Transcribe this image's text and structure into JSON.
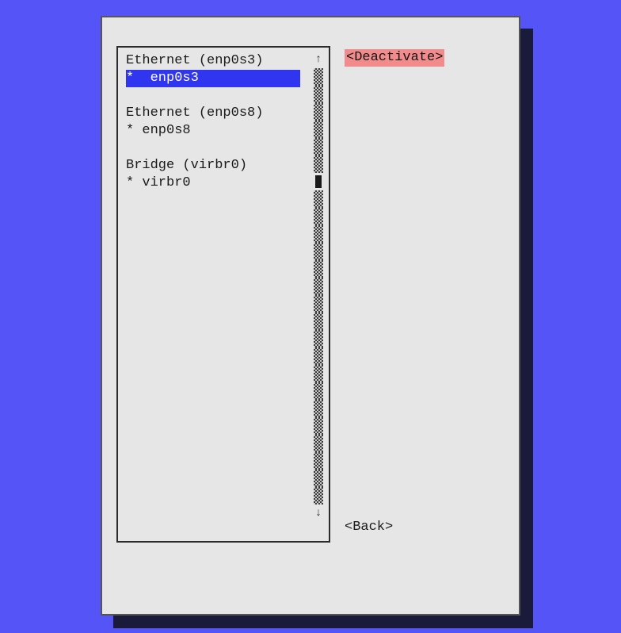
{
  "list": {
    "groups": [
      {
        "header": "Ethernet (enp0s3)",
        "itemPrefix": "* ",
        "itemName": "enp0s3",
        "selected": true
      },
      {
        "header": "Ethernet (enp0s8)",
        "itemPrefix": "* ",
        "itemName": "enp0s8",
        "selected": false
      },
      {
        "header": "Bridge (virbr0)",
        "itemPrefix": "* ",
        "itemName": "virbr0",
        "selected": false
      }
    ],
    "scrollbar": {
      "arrowUp": "↑",
      "arrowDown": "↓"
    }
  },
  "buttons": {
    "deactivate": "<Deactivate>",
    "back": "<Back>"
  }
}
